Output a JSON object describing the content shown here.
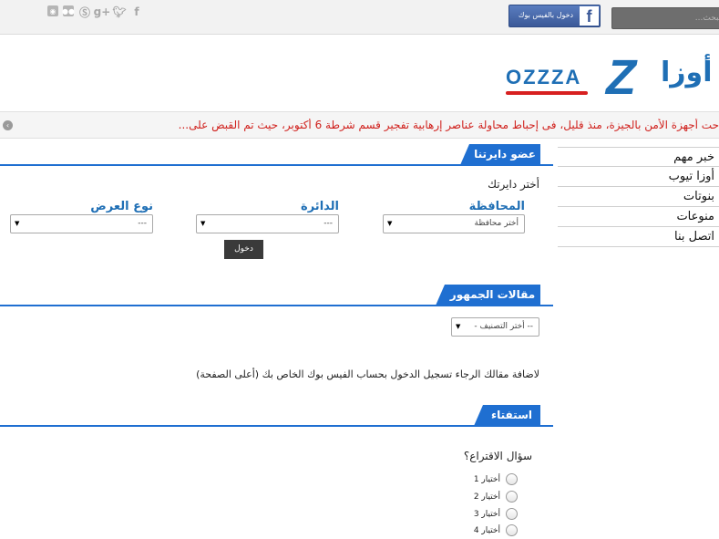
{
  "topbar": {
    "social_icons": [
      "facebook-icon",
      "twitter-icon",
      "googleplus-icon",
      "skype-icon",
      "flickr-icon",
      "rss-icon"
    ],
    "facebook_login_label": "دخول بالفيس بوك",
    "search_placeholder": "البحث..."
  },
  "logo": {
    "latin": "OZZZA",
    "mark": "Z",
    "arabic": "أوزا"
  },
  "ticker": {
    "text": "حت أجهزة الأمن بالجيزة، منذ قليل، فى إحباط محاولة عناصر إرهابية تفجير قسم شرطة 6 أكتوبر، حيث تم القبض على..."
  },
  "nav": {
    "items": [
      {
        "label": "خبر مهم"
      },
      {
        "label": "أوزا تيوب"
      },
      {
        "label": "بنوتات"
      },
      {
        "label": "منوعات"
      },
      {
        "label": "اتصل بنا"
      }
    ]
  },
  "member": {
    "title": "عضو دايرتنا",
    "choose_label": "أختر دايرتك",
    "governorate_label": "المحافظة",
    "governorate_value": "أختر محافظة",
    "district_label": "الدائرة",
    "district_value": "---",
    "display_type_label": "نوع العرض",
    "display_type_value": "---",
    "login_button": "دخول"
  },
  "articles": {
    "title": "مقالات الجمهور",
    "category_value": "-- أختر التصنيف -",
    "note": "لاضافة مقالك الرجاء تسجيل الدخول بحساب الفيس بوك الخاص بك (أعلى الصفحة)"
  },
  "poll": {
    "title": "استفتاء",
    "question": "سؤال الاقتراع؟",
    "options": [
      {
        "label": "أختيار 1"
      },
      {
        "label": "أختيار 2"
      },
      {
        "label": "أختيار 3"
      },
      {
        "label": "أختيار 4"
      }
    ]
  }
}
